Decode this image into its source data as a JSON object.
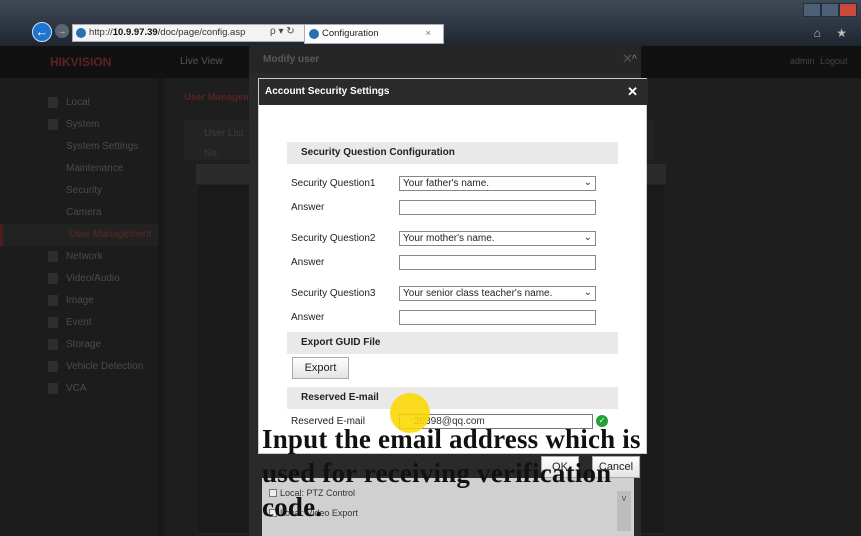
{
  "browser": {
    "url_prefix": "http://",
    "url_host": "10.9.97.39",
    "url_path": "/doc/page/config.asp",
    "address_tools": "ρ ▾ ↻",
    "tab_title": "Configuration",
    "tab_close": "×",
    "right_icons": "⌂ ★",
    "back": "←",
    "forward": "→"
  },
  "app": {
    "logo": "HIKVISION",
    "top_nav": "Live View",
    "user": "admin",
    "logout": "Logout"
  },
  "sidebar": {
    "items": [
      {
        "label": "Local",
        "type": "main"
      },
      {
        "label": "System",
        "type": "main"
      },
      {
        "label": "System Settings",
        "type": "sub"
      },
      {
        "label": "Maintenance",
        "type": "sub"
      },
      {
        "label": "Security",
        "type": "sub"
      },
      {
        "label": "Camera Management",
        "type": "sub"
      },
      {
        "label": "User Management",
        "type": "sub",
        "active": true
      },
      {
        "label": "Network",
        "type": "main"
      },
      {
        "label": "Video/Audio",
        "type": "main"
      },
      {
        "label": "Image",
        "type": "main"
      },
      {
        "label": "Event",
        "type": "main"
      },
      {
        "label": "Storage",
        "type": "main"
      },
      {
        "label": "Vehicle Detection",
        "type": "main"
      },
      {
        "label": "VCA",
        "type": "main"
      }
    ]
  },
  "content": {
    "tab": "User Management",
    "list_header": "User List",
    "col_no": "No."
  },
  "modify_dialog": {
    "title": "Modify user",
    "close": "✕",
    "up_arrow": "^",
    "checkboxes": [
      "Local: PTZ Control",
      "Local: Video Export"
    ],
    "scroll_down": "v",
    "hscroll_left": "<",
    "hscroll_right": ">"
  },
  "account_security": {
    "title": "Account Security Settings",
    "close": "✕",
    "question_section": "Security Question Configuration",
    "questions": [
      {
        "label": "Security Question1",
        "selected": "Your father's name.",
        "answer_label": "Answer"
      },
      {
        "label": "Security Question2",
        "selected": "Your mother's name.",
        "answer_label": "Answer"
      },
      {
        "label": "Security Question3",
        "selected": "Your senior class teacher's name.",
        "answer_label": "Answer"
      }
    ],
    "export_section": "Export GUID File",
    "export_button": "Export",
    "email_section": "Reserved E-mail",
    "email_label": "Reserved E-mail",
    "email_value": "20398@qq.com",
    "ok_button": "OK",
    "cancel_button": "Cancel",
    "dropdown_arrow": "⌄",
    "check_mark": "✓"
  },
  "caption": "Input the email address which is used for receiving verification code."
}
